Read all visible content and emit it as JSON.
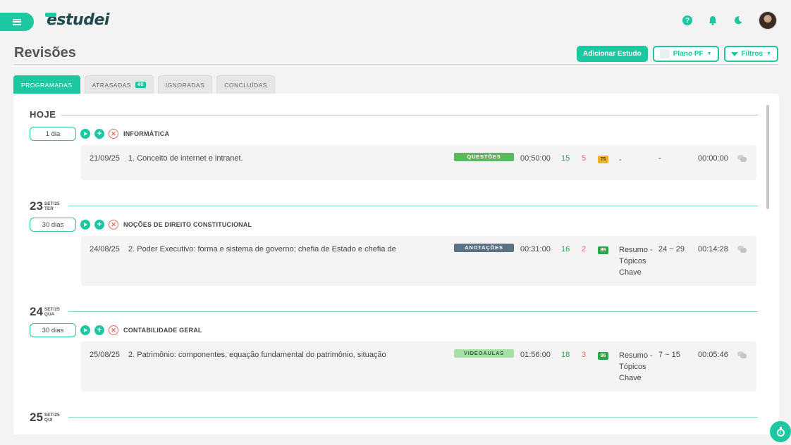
{
  "brand": {
    "logo_text": "estudei"
  },
  "header": {
    "title": "Revisões"
  },
  "actions": {
    "add_study": "Adicionar Estudo",
    "plan": "Plano PF",
    "filters": "Filtros"
  },
  "tabs": [
    {
      "label": "PROGRAMADAS",
      "active": true
    },
    {
      "label": "ATRASADAS",
      "badge": "40"
    },
    {
      "label": "IGNORADAS"
    },
    {
      "label": "CONCLUÍDAS"
    }
  ],
  "colors": {
    "accent": "#1cc7a2",
    "questoes": "#5cb85c",
    "anotacoes": "#5b7185",
    "videoaulas": "#a7e0a7",
    "pct_mid": "#f0b429",
    "pct_high": "#28a745"
  },
  "groups": [
    {
      "day_label": "HOJE",
      "interval": "1 dia",
      "subject": "INFORMÁTICA",
      "item": {
        "date": "21/09/25",
        "topic": "1. Conceito de internet e intranet.",
        "tag": "QUESTÕES",
        "time": "00:50:00",
        "correct": "15",
        "wrong": "5",
        "pct": "75",
        "material": "-",
        "pages": "-",
        "duration": "00:00:00"
      }
    },
    {
      "day_num": "23",
      "month": "SET/25",
      "weekday": "TER",
      "interval": "30 dias",
      "subject": "NOÇÕES DE DIREITO CONSTITUCIONAL",
      "item": {
        "date": "24/08/25",
        "topic": "2. Poder Executivo: forma e sistema de governo; chefia de Estado e chefia de",
        "tag": "ANOTAÇÕES",
        "time": "00:31:00",
        "correct": "16",
        "wrong": "2",
        "pct": "89",
        "material": "Resumo - Tópicos Chave",
        "pages": "24 ~ 29",
        "duration": "00:14:28"
      }
    },
    {
      "day_num": "24",
      "month": "SET/25",
      "weekday": "QUA",
      "interval": "30 dias",
      "subject": "CONTABILIDADE GERAL",
      "item": {
        "date": "25/08/25",
        "topic": "2. Patrimônio: componentes, equação fundamental do patrimônio, situação",
        "tag": "VIDEOAULAS",
        "time": "01:56:00",
        "correct": "18",
        "wrong": "3",
        "pct": "86",
        "material": "Resumo - Tópicos Chave",
        "pages": "7 ~ 15",
        "duration": "00:05:46"
      }
    },
    {
      "day_num": "25",
      "month": "SET/25",
      "weekday": "QUI"
    }
  ]
}
